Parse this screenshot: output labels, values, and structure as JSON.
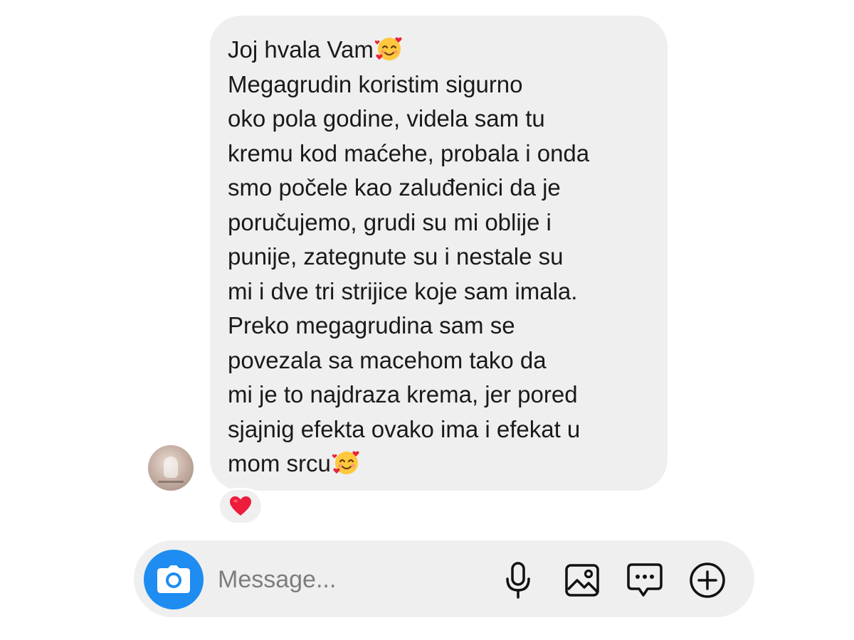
{
  "conversation": {
    "message": {
      "lines": [
        "Joj hvala Vam",
        "Megagrudin koristim sigurno",
        "oko pola godine, videla sam tu",
        "kremu kod maćehe, probala i onda",
        "smo počele kao zaluđenici da je",
        "poručujemo, grudi su mi oblije i",
        "punije, zategnute su i nestale su",
        "mi i dve tri strijice koje sam imala.",
        "Preko megagrudina sam se",
        "povezala sa macehom tako da",
        "mi je to najdraza krema, jer pored",
        "sjajnig efekta ovako ima i efekat u",
        "mom srcu"
      ],
      "emoji_icon": "smiling-face-with-hearts",
      "reaction_icon": "red-heart"
    }
  },
  "composer": {
    "placeholder": "Message...",
    "value": "",
    "camera_icon": "camera-icon",
    "tools": [
      "microphone-icon",
      "image-gallery-icon",
      "chat-bubble-icon",
      "plus-circle-icon"
    ],
    "accent_color": "#1e8cf0"
  }
}
